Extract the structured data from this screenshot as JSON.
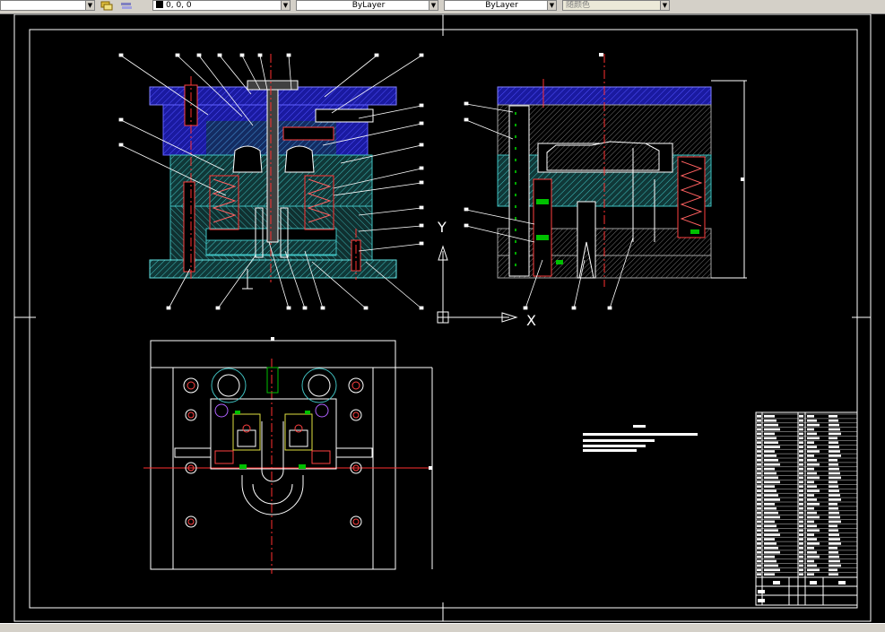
{
  "toolbar": {
    "color_value": "0, 0, 0",
    "linetype_value": "ByLayer",
    "lineweight_value": "ByLayer",
    "plotstyle_value": "随颜色"
  },
  "canvas": {
    "ucs_x_label": "X",
    "ucs_y_label": "Y"
  },
  "colors": {
    "background": "#000000",
    "frame": "#ffffff",
    "hatch_blue": "#2020c0",
    "hatch_cyan": "#40c0c0",
    "centerline_red": "#ff2020",
    "highlight_green": "#00e000",
    "leader_white": "#ffffff"
  }
}
